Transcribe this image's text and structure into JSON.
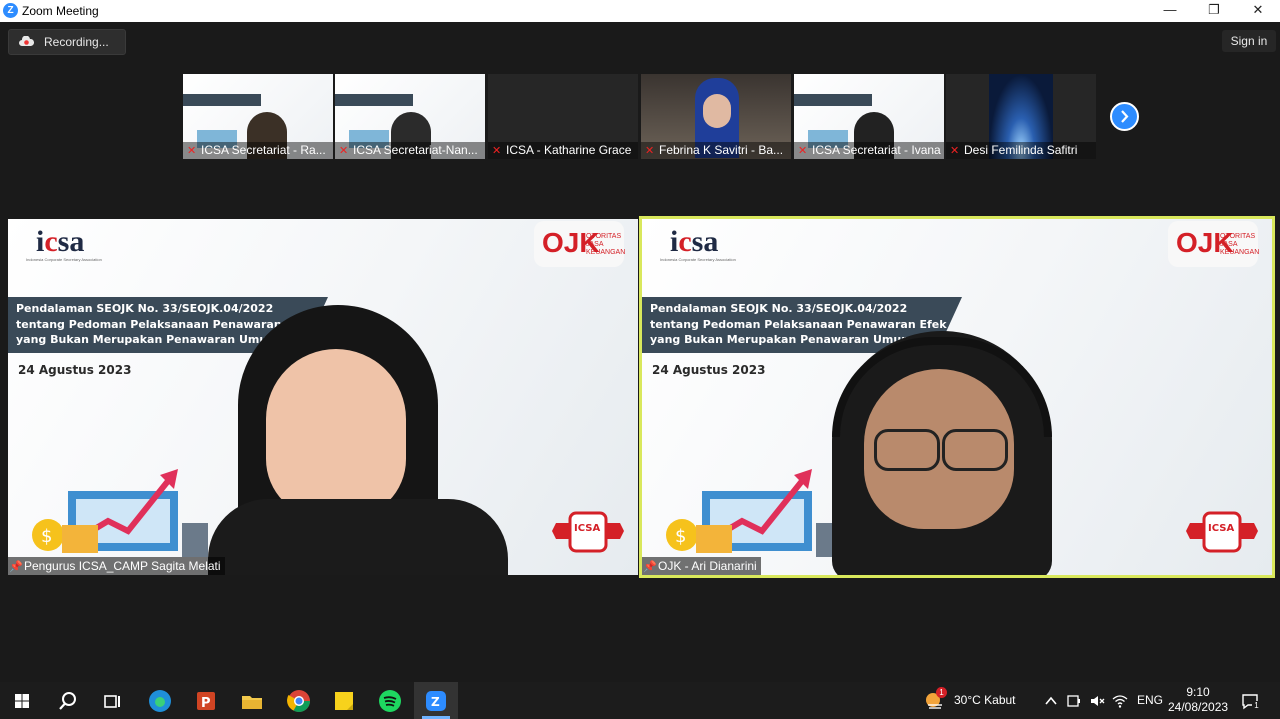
{
  "window": {
    "title": "Zoom Meeting",
    "minimize": "—",
    "restore": "❐",
    "close": "✕"
  },
  "toolbar": {
    "recording_label": "Recording...",
    "sign_in_label": "Sign in"
  },
  "thumbnails": [
    {
      "name": "ICSA Secretariat - Ra...",
      "muted": true
    },
    {
      "name": "ICSA Secretariat-Nan...",
      "muted": true
    },
    {
      "name": "ICSA - Katharine Grace",
      "muted": true
    },
    {
      "name": "Febrina K Savitri - Ba...",
      "muted": true
    },
    {
      "name": "ICSA Secretariat - Ivana",
      "muted": true
    },
    {
      "name": "Desi Femilinda Safitri",
      "muted": true
    }
  ],
  "next_page_icon": "chevron-right-icon",
  "slide": {
    "logo_prefix": "i",
    "logo_mid": "c",
    "logo_suffix": "sa",
    "logo_sub": "Indonesia Corporate Secretary Association",
    "ojk_mark": "OJK",
    "ojk_text": "OTORITAS JASA KEUANGAN",
    "line1": "Pendalaman SEOJK No. 33/SEOJK.04/2022",
    "line2": "tentang Pedoman Pelaksanaan Penawaran Efek",
    "line3": "yang Bukan Merupakan Penawaran Umum",
    "date": "24 Agustus 2023",
    "badge": "ICSA"
  },
  "videos": [
    {
      "name": "Pengurus ICSA_CAMP Sagita Melati",
      "active": false
    },
    {
      "name": "OJK - Ari Dianarini",
      "active": true
    }
  ],
  "colors": {
    "zoom_blue": "#2d8cff",
    "active_border": "#d9e85c",
    "mute_red": "#e22222",
    "banner": "#3a4a58",
    "brand_red": "#d42027"
  },
  "taskbar": {
    "apps": [
      "windows-start-icon",
      "search-icon",
      "task-view-icon",
      "edge-icon",
      "powerpoint-icon",
      "file-explorer-icon",
      "chrome-icon",
      "sticky-notes-icon",
      "spotify-icon",
      "zoom-icon"
    ],
    "weather_badge": "1",
    "weather": "30°C  Kabut",
    "lang": "ENG",
    "time": "9:10",
    "date": "24/08/2023",
    "notification_count": "1"
  }
}
